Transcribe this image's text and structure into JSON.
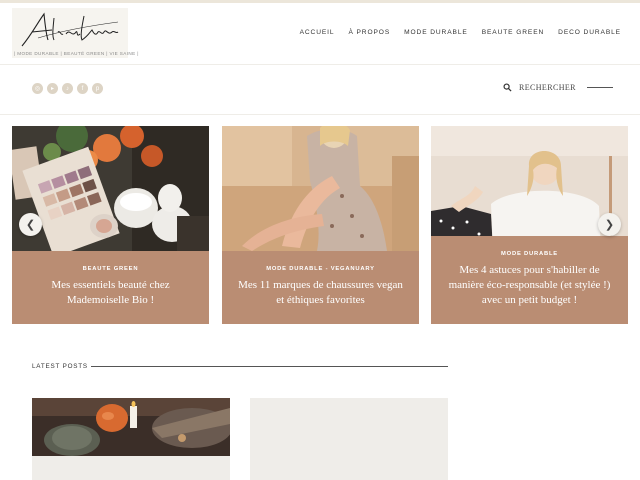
{
  "header": {
    "logo": {
      "script_text": "Alias Louise",
      "tagline": "| MODE DURABLE | BEAUTÉ GREEN | VIE SAINE |"
    },
    "nav": [
      {
        "label": "ACCUEIL"
      },
      {
        "label": "À PROPOS"
      },
      {
        "label": "MODE DURABLE"
      },
      {
        "label": "BEAUTE GREEN"
      },
      {
        "label": "DECO DURABLE"
      }
    ]
  },
  "social": [
    {
      "icon": "instagram-icon"
    },
    {
      "icon": "youtube-icon"
    },
    {
      "icon": "tiktok-icon"
    },
    {
      "icon": "facebook-icon"
    },
    {
      "icon": "pinterest-icon"
    }
  ],
  "search": {
    "label": "RECHERCHER",
    "icon": "search-icon"
  },
  "slider": {
    "slides": [
      {
        "category": "BEAUTE GREEN",
        "title": "Mes essentiels beauté chez Mademoiselle Bio !"
      },
      {
        "category": "MODE DURABLE - VEGANUARY",
        "title": "Mes 11 marques de chaussures vegan et éthiques favorites"
      },
      {
        "category": "MODE DURABLE",
        "title": "Mes 4 astuces pour s'habiller de manière éco-responsable (et stylée !) avec un petit budget !"
      }
    ],
    "prev_icon": "chevron-left-icon",
    "next_icon": "chevron-right-icon"
  },
  "latest_posts": {
    "label": "LATEST POSTS"
  },
  "colors": {
    "panel": "#ba8d73",
    "social": "#ddd4c5",
    "background": "#ffffff"
  }
}
